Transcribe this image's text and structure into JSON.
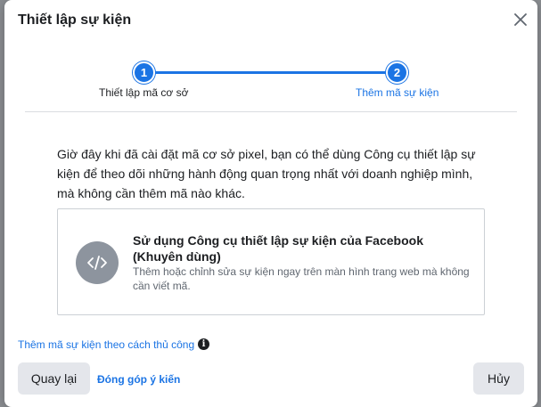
{
  "dialog": {
    "title": "Thiết lập sự kiện"
  },
  "stepper": {
    "steps": [
      {
        "number": "1",
        "label": "Thiết lập mã cơ sở",
        "state": "completed"
      },
      {
        "number": "2",
        "label": "Thêm mã sự kiện",
        "state": "active"
      }
    ]
  },
  "content": {
    "intro": "Giờ đây khi đã cài đặt mã cơ sở pixel, bạn có thể dùng Công cụ thiết lập sự kiện để theo dõi những hành động quan trọng nhất với doanh nghiệp mình, mà không cần thêm mã nào khác.",
    "option_card": {
      "icon": "code-icon",
      "title": "Sử dụng Công cụ thiết lập sự kiện của Facebook (Khuyên dùng)",
      "description": "Thêm hoặc chỉnh sửa sự kiện ngay trên màn hình trang web mà không cần viết mã."
    },
    "manual_link": "Thêm mã sự kiện theo cách thủ công"
  },
  "footer": {
    "back_label": "Quay lại",
    "feedback_label": "Đóng góp ý kiến",
    "cancel_label": "Hủy"
  },
  "colors": {
    "accent": "#1b74e4",
    "text": "#1c1e21",
    "muted": "#606770",
    "button_bg": "#e4e6eb",
    "icon_bg": "#8d949e"
  }
}
